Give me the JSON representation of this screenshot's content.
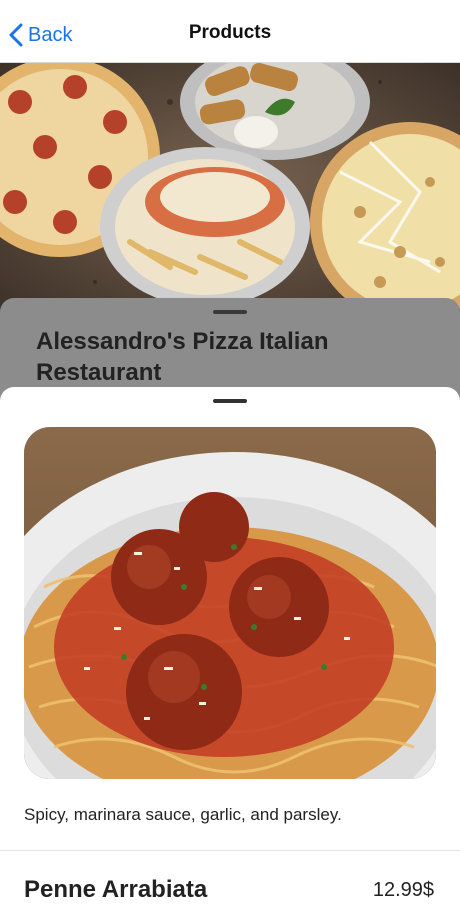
{
  "nav": {
    "back_label": "Back",
    "title": "Products"
  },
  "restaurant": {
    "name": "Alessandro's Pizza Italian Restaurant"
  },
  "product": {
    "description": "Spicy, marinara sauce, garlic, and parsley.",
    "name": "Penne Arrabiata",
    "price": "12.99$"
  },
  "colors": {
    "accent": "#1a73e8",
    "dim_sheet": "#8c8c8c"
  }
}
